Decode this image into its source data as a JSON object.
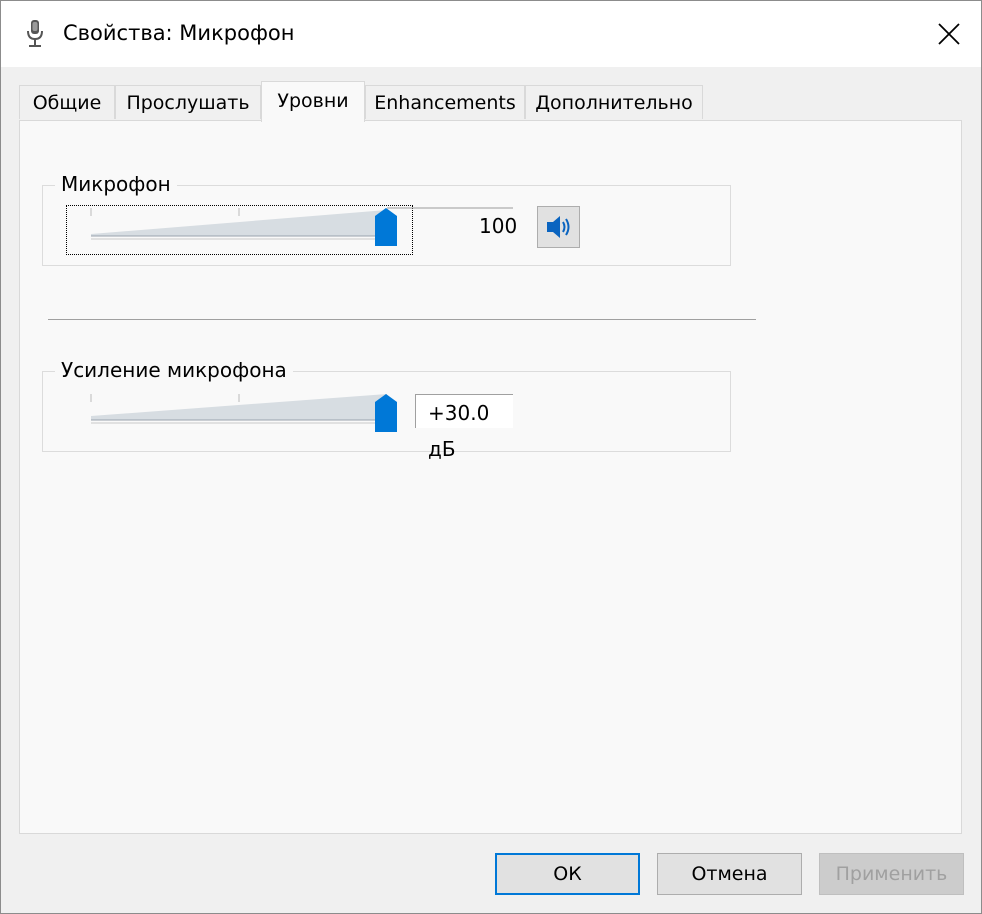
{
  "window": {
    "title": "Свойства: Микрофон",
    "title_icon": "microphone-icon",
    "close_icon": "close-icon"
  },
  "tabs": [
    {
      "label": "Общие",
      "active": false
    },
    {
      "label": "Прослушать",
      "active": false
    },
    {
      "label": "Уровни",
      "active": true
    },
    {
      "label": "Enhancements",
      "active": false
    },
    {
      "label": "Дополнительно",
      "active": false
    }
  ],
  "levels": {
    "microphone": {
      "label": "Микрофон",
      "value_text": "100",
      "level": 1.0,
      "mute_icon": "speaker-icon"
    },
    "boost": {
      "label": "Усиление микрофона",
      "value_text": "+30.0 дБ",
      "level": 1.0
    }
  },
  "buttons": {
    "ok": "ОК",
    "cancel": "Отмена",
    "apply": "Применить"
  },
  "colors": {
    "accent": "#0078d7",
    "thumb": "#0078d7"
  }
}
